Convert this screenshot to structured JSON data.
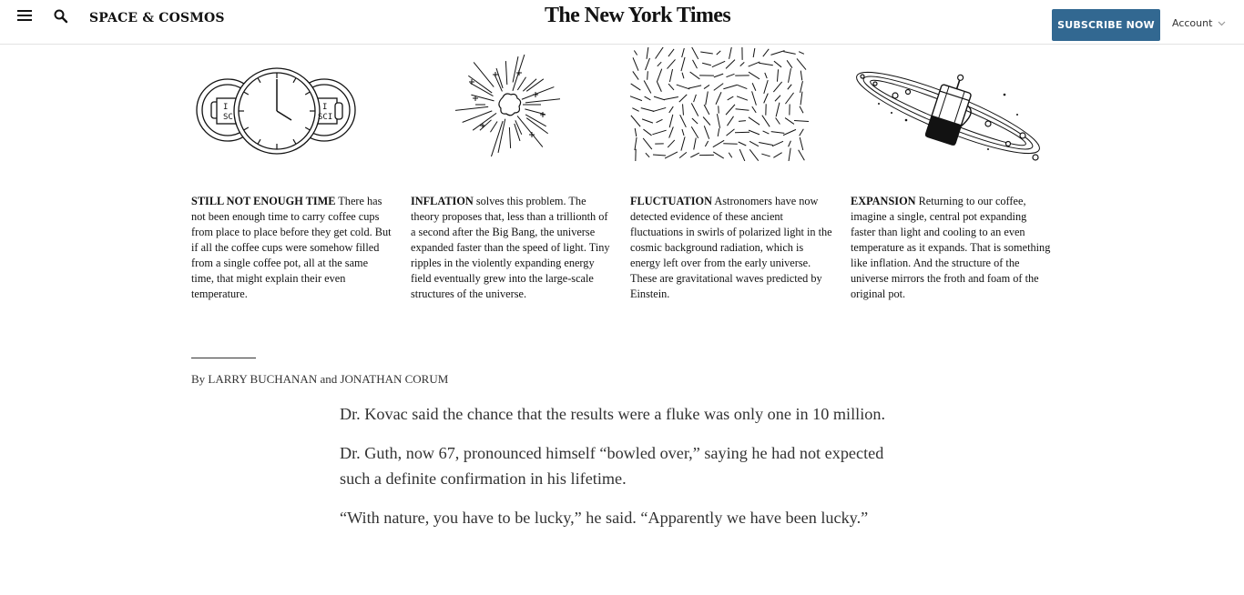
{
  "header": {
    "menu_icon": "hamburger-menu-icon",
    "search_icon": "search-icon",
    "section_title": "SPACE & COSMOS",
    "logo_text": "The New York Times",
    "subscribe_label": "SUBSCRIBE NOW",
    "account_label": "Account",
    "subscribe_color": "#326891"
  },
  "panels": [
    {
      "icon": "coffee-cups-clock-illustration",
      "mug_labels": [
        "I",
        "SC",
        "I",
        "SCI"
      ],
      "heading": "STILL NOT ENOUGH TIME",
      "body": " There has not been enough time to carry coffee cups from place to place before they get cold. But if all the coffee cups were somehow filled from a single coffee pot, all at the same time, that might explain their even temperature."
    },
    {
      "icon": "big-bang-burst-illustration",
      "heading": "INFLATION",
      "body": " solves this problem. The theory proposes that, less than a trillionth of a second after the Big Bang, the universe expanded faster than the speed of light. Tiny ripples in the violently expanding energy field eventually grew into the large-scale structures of the universe."
    },
    {
      "icon": "polarization-swirl-illustration",
      "heading": "FLUCTUATION",
      "body": " Astronomers have now detected evidence of these ancient fluctuations in swirls of polarized light in the cosmic background radiation, which is energy left over from the early universe. These are gravitational waves predicted by Einstein."
    },
    {
      "icon": "coffee-press-galaxy-illustration",
      "heading": "EXPANSION",
      "body": " Returning to our coffee, imagine a single, central pot expanding faster than light and cooling to an even temperature as it expands. That is something like inflation. And the structure of the universe mirrors the froth and foam of the original pot."
    }
  ],
  "byline": "By LARRY BUCHANAN and JONATHAN CORUM",
  "article": {
    "paragraphs": [
      "Dr. Kovac said the chance that the results were a fluke was only one in 10 million.",
      "Dr. Guth, now 67, pronounced himself “bowled over,” saying he had not expected such a definite confirmation in his lifetime.",
      "“With nature, you have to be lucky,” he said. “Apparently we have been lucky.”"
    ]
  }
}
